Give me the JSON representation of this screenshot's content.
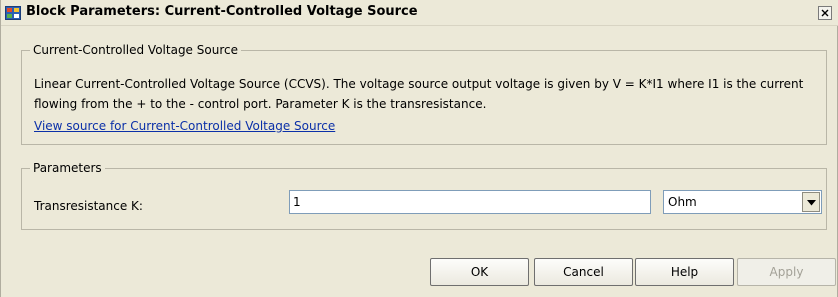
{
  "window": {
    "title": "Block Parameters: Current-Controlled Voltage Source",
    "close_glyph": "✕"
  },
  "description_group": {
    "legend": "Current-Controlled Voltage Source",
    "text": "Linear Current-Controlled Voltage Source (CCVS). The voltage source output voltage is given by V = K*I1 where I1 is the current flowing from the + to the - control port. Parameter K is the transresistance.",
    "link": "View source for Current-Controlled Voltage Source"
  },
  "parameters_group": {
    "legend": "Parameters",
    "transresistance_label": "Transresistance K:",
    "transresistance_value": "1",
    "unit_selected": "Ohm"
  },
  "buttons": {
    "ok": "OK",
    "cancel": "Cancel",
    "help": "Help",
    "apply": "Apply"
  },
  "icons": {
    "app": "simulink-block-icon",
    "close": "close-icon",
    "dropdown": "chevron-down-icon"
  }
}
